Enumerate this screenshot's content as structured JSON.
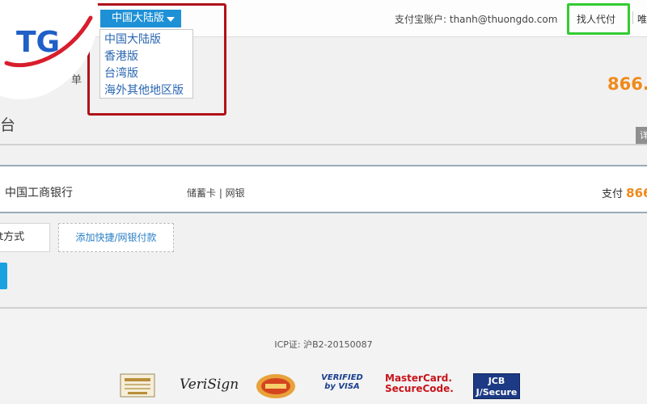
{
  "header": {
    "account_label": "支付宝账户:",
    "account_email": "thanh@thuongdo.com",
    "friend_pay": "找人代付",
    "more": "唯一"
  },
  "region": {
    "selected": "中国大陆版",
    "options": [
      "中国大陆版",
      "香港版",
      "台湾版",
      "海外其他地区版"
    ]
  },
  "summary": {
    "order_clip": "单",
    "amount": "866.",
    "cashier_title": "台",
    "detail_tab": "详"
  },
  "bank": {
    "name": "中国工商银行",
    "type": "储蓄卡 | 网银",
    "pay_label": "支付",
    "pay_amount": "866"
  },
  "methods": {
    "other": "t方式",
    "add": "添加快捷/网银付款"
  },
  "footer": {
    "icp": "ICP证: 沪B2-20150087",
    "seals": [
      "VeriSign",
      "VERIFIED by VISA",
      "MasterCard. SecureCode.",
      "JCB J/Secure"
    ]
  },
  "logo": {
    "text": "TG"
  },
  "colors": {
    "accent_blue": "#1e90d6",
    "amount_orange": "#ef8a1a",
    "highlight_red": "#b01219",
    "highlight_green": "#33cc33"
  }
}
